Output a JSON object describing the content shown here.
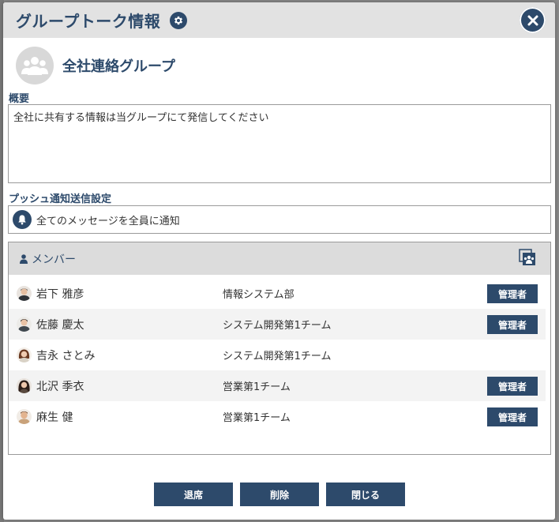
{
  "dialog": {
    "title": "グループトーク情報",
    "group_name": "全社連絡グループ"
  },
  "overview": {
    "label": "概要",
    "text": "全社に共有する情報は当グループにて発信してください"
  },
  "push": {
    "label": "プッシュ通知送信設定",
    "value": "全てのメッセージを全員に通知"
  },
  "members": {
    "title": "メンバー",
    "rows": [
      {
        "name": "岩下 雅彦",
        "dept": "情報システム部",
        "badge": "管理者"
      },
      {
        "name": "佐藤 慶太",
        "dept": "システム開発第1チーム",
        "badge": "管理者"
      },
      {
        "name": "吉永 さとみ",
        "dept": "システム開発第1チーム",
        "badge": ""
      },
      {
        "name": "北沢 季衣",
        "dept": "営業第1チーム",
        "badge": "管理者"
      },
      {
        "name": "麻生 健",
        "dept": "営業第1チーム",
        "badge": "管理者"
      }
    ]
  },
  "buttons": {
    "leave": "退席",
    "delete": "削除",
    "close": "閉じる"
  },
  "icons": {
    "settings": "gear-icon",
    "close": "close-icon",
    "group_avatar": "group-users-icon",
    "push": "bell-icon",
    "member": "user-icon",
    "manage_members": "member-manage-icon"
  },
  "colors": {
    "accent": "#2d4a6b",
    "header_bg": "#e2e2e2",
    "row_alt": "#f3f3f3"
  }
}
